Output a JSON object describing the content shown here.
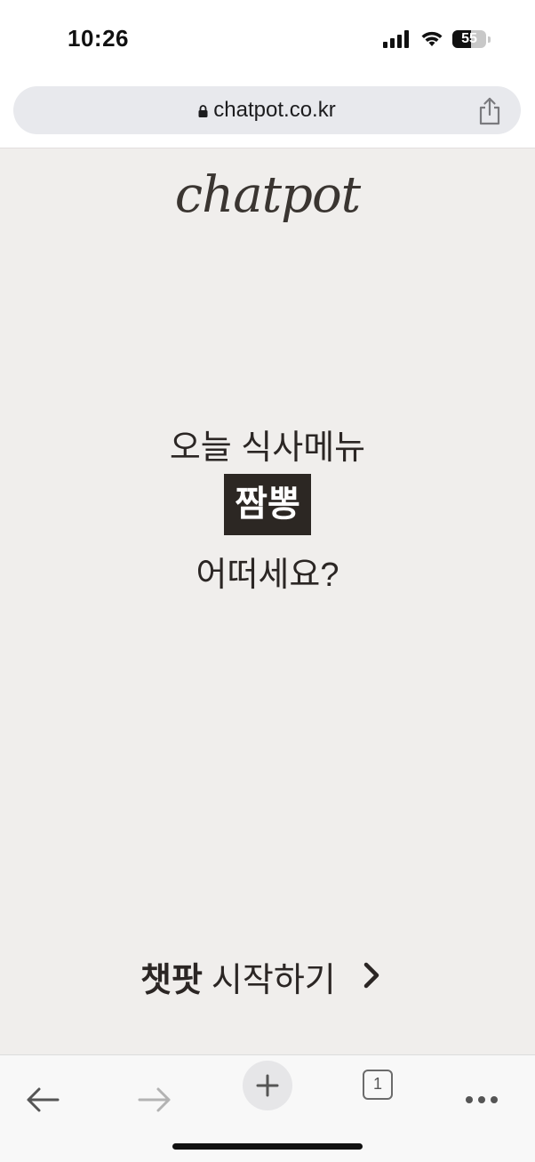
{
  "status_bar": {
    "time": "10:26",
    "battery_level": "55",
    "battery_fraction": 0.55
  },
  "browser": {
    "url": "chatpot.co.kr",
    "tab_count": "1"
  },
  "page": {
    "logo": "chatpot",
    "headline": "오늘 식사메뉴",
    "menu_item": "짬뽕",
    "question": "어떠세요?",
    "cta_brand": "챗팟",
    "cta_label": "시작하기"
  },
  "colors": {
    "page_background": "#f0eeec",
    "badge_background": "#2c2723",
    "text": "#2b2624"
  },
  "icons": [
    "signal-icon",
    "wifi-icon",
    "lock-icon",
    "share-icon",
    "chevron-right-icon",
    "back-arrow-icon",
    "forward-arrow-icon",
    "plus-icon",
    "more-icon"
  ]
}
